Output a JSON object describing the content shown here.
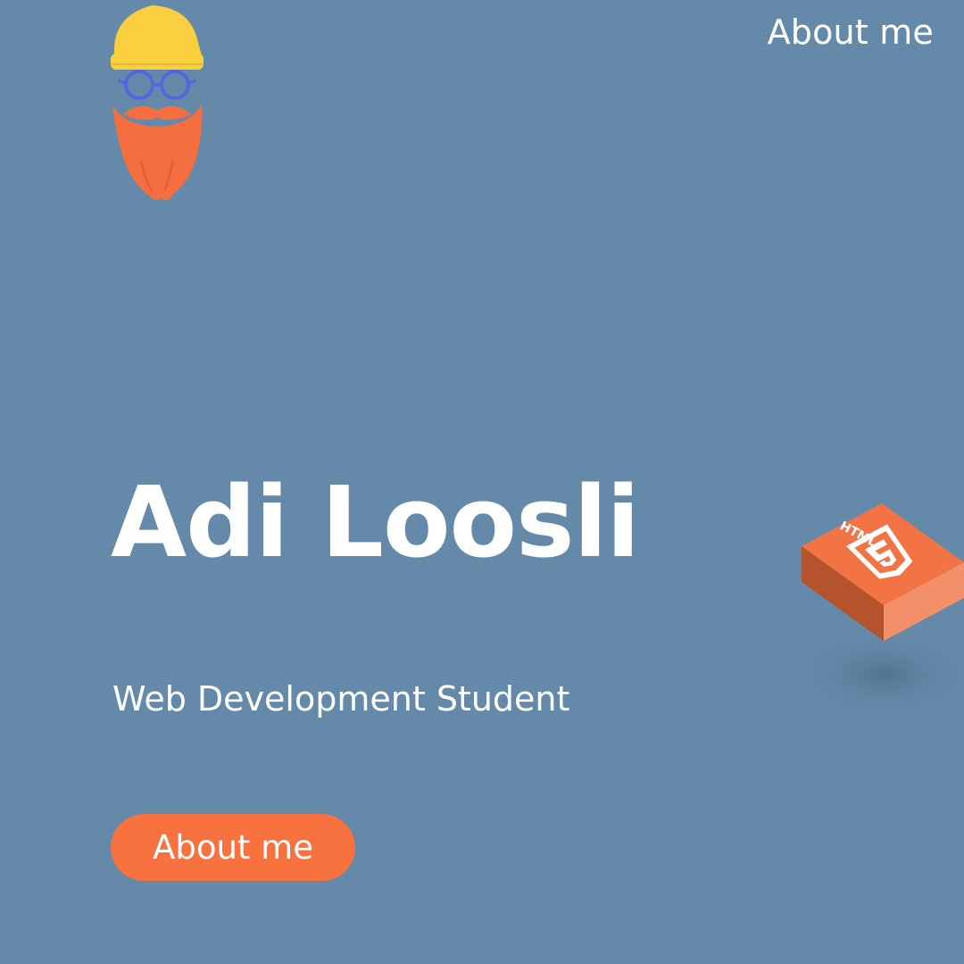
{
  "nav": {
    "about_label": "About me"
  },
  "hero": {
    "name": "Adi Loosli",
    "subtitle": "Web Development Student",
    "cta_label": "About me"
  },
  "decoration": {
    "logo_icon": "bearded-hipster-avatar-icon",
    "badge_icon": "html5-tile-icon",
    "badge_text": "HTML"
  },
  "colors": {
    "background": "#658aa9",
    "accent": "#f7723f",
    "hat": "#f9cf3f",
    "glasses": "#5566dd",
    "text": "#ffffff"
  }
}
